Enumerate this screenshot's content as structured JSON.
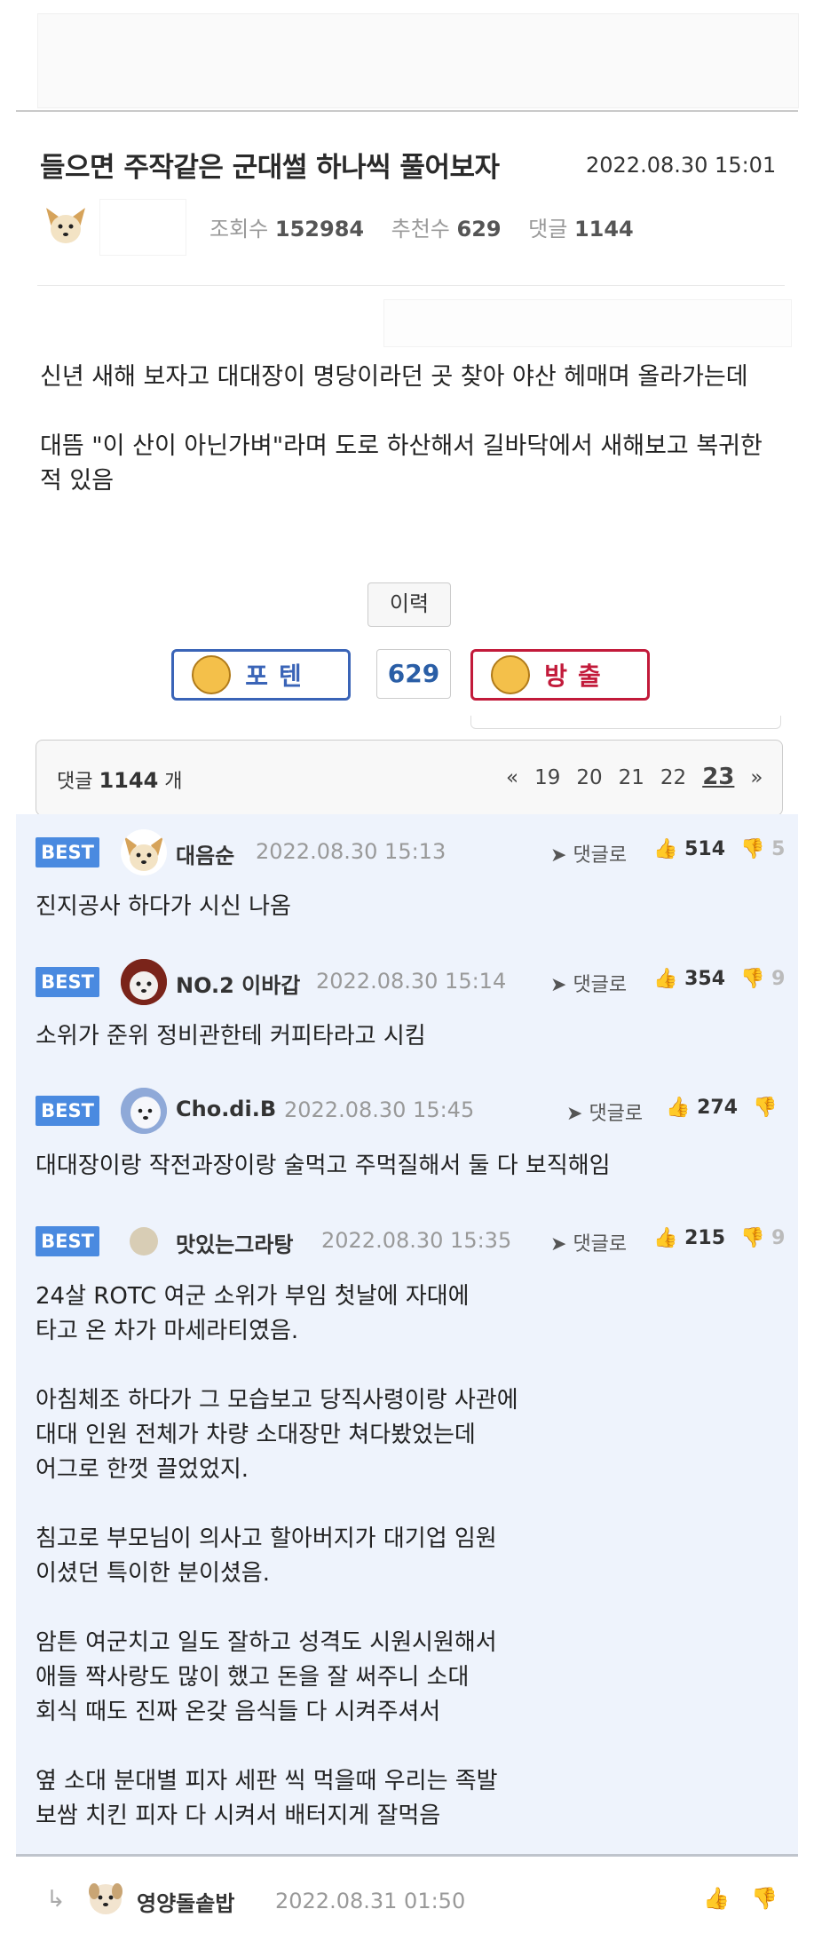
{
  "post": {
    "title": "들으면 주작같은 군대썰 하나씩 풀어보자",
    "date": "2022.08.30 15:01",
    "views_label": "조회수",
    "views": "152984",
    "recommends_label": "추천수",
    "recommends": "629",
    "comments_label": "댓글",
    "comments": "1144",
    "body": [
      "신년 새해 보자고 대대장이 명당이라던 곳 찾아 야산 헤매며 올라가는데",
      "대뜸 \"이 산이 아닌가벼\"라며 도로 하산해서 길바닥에서 새해보고 복귀한 적 있음"
    ],
    "history_label": "이력",
    "vote_up_label": "포텐",
    "vote_count": "629",
    "vote_down_label": "방출"
  },
  "comment_bar": {
    "prefix": "댓글",
    "count": "1144",
    "suffix": "개",
    "pages": [
      "«",
      "19",
      "20",
      "21",
      "22",
      "23",
      "»"
    ],
    "current_page": "23"
  },
  "comments": [
    {
      "badge": "BEST",
      "name": "대음순",
      "date": "2022.08.30 15:13",
      "reply_label": "댓글로",
      "likes": "514",
      "dislikes": "5",
      "text": "진지공사 하다가 시신 나옴"
    },
    {
      "badge": "BEST",
      "name": "NO.2 이바갑",
      "date": "2022.08.30 15:14",
      "reply_label": "댓글로",
      "likes": "354",
      "dislikes": "9",
      "text": "소위가 준위 정비관한테 커피타라고 시킴"
    },
    {
      "badge": "BEST",
      "name": "Cho.di.B",
      "date": "2022.08.30 15:45",
      "reply_label": "댓글로",
      "likes": "274",
      "dislikes": "",
      "text": "대대장이랑 작전과장이랑 술먹고 주먹질해서 둘 다 보직해임"
    },
    {
      "badge": "BEST",
      "name": "맛있는그라탕",
      "date": "2022.08.30 15:35",
      "reply_label": "댓글로",
      "likes": "215",
      "dislikes": "9",
      "text": "24살 ROTC 여군 소위가 부임 첫날에 자대에\n타고 온 차가 마세라티였음.\n\n아침체조 하다가 그 모습보고 당직사령이랑 사관에\n대대 인원 전체가 차량 소대장만 쳐다봤었는데\n어그로 한껏 끌었었지.\n\n침고로 부모님이 의사고 할아버지가 대기업 임원\n이셨던 특이한 분이셨음.\n\n암튼 여군치고 일도 잘하고 성격도 시원시원해서\n애들 짝사랑도 많이 했고 돈을 잘 써주니 소대\n회식 때도 진짜 온갖 음식들 다 시켜주셔서\n\n옆 소대 분대별 피자 세판 씩 먹을때 우리는 족발\n보쌈 치킨 피자 다 시켜서 배터지게 잘먹음"
    }
  ],
  "reply": {
    "name": "영양돌솥밥",
    "date": "2022.08.31 01:50"
  },
  "colors": {
    "best_badge": "#4a8ae0",
    "comment_bg": "#eef3fc",
    "vote_up": "#3a64b7",
    "vote_down": "#c21a3a",
    "vote_count": "#2a5ea6"
  }
}
